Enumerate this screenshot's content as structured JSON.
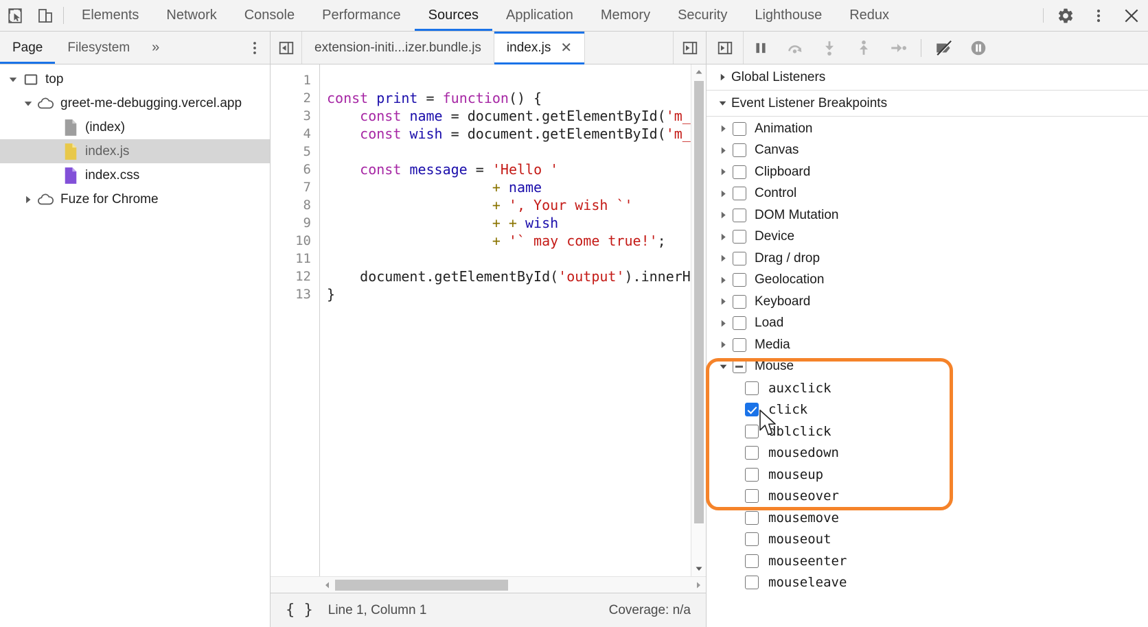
{
  "topbar": {
    "inspect_icon": "inspect-cursor-icon",
    "device_icon": "device-toolbar-icon",
    "tabs": [
      {
        "label": "Elements",
        "active": false
      },
      {
        "label": "Network",
        "active": false
      },
      {
        "label": "Console",
        "active": false
      },
      {
        "label": "Performance",
        "active": false
      },
      {
        "label": "Sources",
        "active": true
      },
      {
        "label": "Application",
        "active": false
      },
      {
        "label": "Memory",
        "active": false
      },
      {
        "label": "Security",
        "active": false
      },
      {
        "label": "Lighthouse",
        "active": false
      },
      {
        "label": "Redux",
        "active": false
      }
    ],
    "settings_icon": "gear-icon",
    "more_icon": "kebab-menu-icon",
    "close_icon": "close-icon",
    "accent_color": "#1a73e8"
  },
  "navigator": {
    "tabs": [
      {
        "label": "Page",
        "active": true
      },
      {
        "label": "Filesystem",
        "active": false
      }
    ],
    "more_label": "»",
    "kebab_icon": "kebab-menu-icon",
    "tree": [
      {
        "label": "top",
        "indent": 0,
        "arrow": "down",
        "icon": "frame-icon",
        "selected": false
      },
      {
        "label": "greet-me-debugging.vercel.app",
        "indent": 1,
        "arrow": "down",
        "icon": "cloud-icon",
        "selected": false
      },
      {
        "label": "(index)",
        "indent": 2,
        "arrow": "none",
        "icon": "document-icon",
        "selected": false
      },
      {
        "label": "index.js",
        "indent": 2,
        "arrow": "none",
        "icon": "js-file-icon",
        "selected": true
      },
      {
        "label": "index.css",
        "indent": 2,
        "arrow": "none",
        "icon": "css-file-icon",
        "selected": false
      },
      {
        "label": "Fuze for Chrome",
        "indent": 1,
        "arrow": "right",
        "icon": "cloud-icon",
        "selected": false
      }
    ]
  },
  "editor": {
    "nav_back_icon": "show-navigator-icon",
    "expand_icon": "show-debugger-icon",
    "tabs": [
      {
        "label": "extension-initi...izer.bundle.js",
        "active": false,
        "closable": false
      },
      {
        "label": "index.js",
        "active": true,
        "closable": true,
        "close_label": "✕"
      }
    ],
    "line_numbers": [
      1,
      2,
      3,
      4,
      5,
      6,
      7,
      8,
      9,
      10,
      11,
      12,
      13
    ],
    "lines": [
      [],
      [
        {
          "t": "const",
          "c": "kw"
        },
        {
          "t": " ",
          "c": "pl"
        },
        {
          "t": "print",
          "c": "id"
        },
        {
          "t": " = ",
          "c": "pl"
        },
        {
          "t": "function",
          "c": "kw"
        },
        {
          "t": "() {",
          "c": "pl"
        }
      ],
      [
        {
          "t": "    ",
          "c": "pl"
        },
        {
          "t": "const",
          "c": "kw"
        },
        {
          "t": " ",
          "c": "pl"
        },
        {
          "t": "name",
          "c": "id"
        },
        {
          "t": " = document.getElementById(",
          "c": "pl"
        },
        {
          "t": "'m_na",
          "c": "str"
        }
      ],
      [
        {
          "t": "    ",
          "c": "pl"
        },
        {
          "t": "const",
          "c": "kw"
        },
        {
          "t": " ",
          "c": "pl"
        },
        {
          "t": "wish",
          "c": "id"
        },
        {
          "t": " = document.getElementById(",
          "c": "pl"
        },
        {
          "t": "'m_wi",
          "c": "str"
        }
      ],
      [],
      [
        {
          "t": "    ",
          "c": "pl"
        },
        {
          "t": "const",
          "c": "kw"
        },
        {
          "t": " ",
          "c": "pl"
        },
        {
          "t": "message",
          "c": "id"
        },
        {
          "t": " = ",
          "c": "pl"
        },
        {
          "t": "'Hello '",
          "c": "str"
        }
      ],
      [
        {
          "t": "                    ",
          "c": "pl"
        },
        {
          "t": "+",
          "c": "op"
        },
        {
          "t": " ",
          "c": "pl"
        },
        {
          "t": "name",
          "c": "id"
        }
      ],
      [
        {
          "t": "                    ",
          "c": "pl"
        },
        {
          "t": "+",
          "c": "op"
        },
        {
          "t": " ",
          "c": "pl"
        },
        {
          "t": "', Your wish `'",
          "c": "str"
        }
      ],
      [
        {
          "t": "                    ",
          "c": "pl"
        },
        {
          "t": "+",
          "c": "op"
        },
        {
          "t": " ",
          "c": "pl"
        },
        {
          "t": "+",
          "c": "op"
        },
        {
          "t": " ",
          "c": "pl"
        },
        {
          "t": "wish",
          "c": "id"
        }
      ],
      [
        {
          "t": "                    ",
          "c": "pl"
        },
        {
          "t": "+",
          "c": "op"
        },
        {
          "t": " ",
          "c": "pl"
        },
        {
          "t": "'` may come true!'",
          "c": "str"
        },
        {
          "t": ";",
          "c": "pl"
        }
      ],
      [],
      [
        {
          "t": "    document.getElementById(",
          "c": "pl"
        },
        {
          "t": "'output'",
          "c": "str"
        },
        {
          "t": ").innerHTM",
          "c": "pl"
        }
      ],
      [
        {
          "t": "}",
          "c": "pl"
        }
      ]
    ],
    "status": {
      "format_icon": "pretty-print-braces-icon",
      "position": "Line 1, Column 1",
      "coverage": "Coverage: n/a"
    }
  },
  "debugger": {
    "collapse_icon": "show-navigator-panel-icon",
    "buttons": [
      {
        "name": "pause-script-execution",
        "icon": "pause-icon"
      },
      {
        "name": "step-over-next-function-call",
        "icon": "step-over-icon"
      },
      {
        "name": "step-into-next-function-call",
        "icon": "step-into-icon"
      },
      {
        "name": "step-out-of-current-function",
        "icon": "step-out-icon"
      },
      {
        "name": "step",
        "icon": "step-icon"
      },
      {
        "name": "deactivate-breakpoints",
        "icon": "deactivate-breakpoints-icon"
      },
      {
        "name": "pause-on-exceptions",
        "icon": "pause-on-exceptions-icon"
      }
    ],
    "sections": [
      {
        "label": "Global Listeners",
        "expanded": false
      },
      {
        "label": "Event Listener Breakpoints",
        "expanded": true
      }
    ],
    "categories": [
      {
        "label": "Animation",
        "expanded": false,
        "state": "unchecked"
      },
      {
        "label": "Canvas",
        "expanded": false,
        "state": "unchecked"
      },
      {
        "label": "Clipboard",
        "expanded": false,
        "state": "unchecked"
      },
      {
        "label": "Control",
        "expanded": false,
        "state": "unchecked"
      },
      {
        "label": "DOM Mutation",
        "expanded": false,
        "state": "unchecked"
      },
      {
        "label": "Device",
        "expanded": false,
        "state": "unchecked"
      },
      {
        "label": "Drag / drop",
        "expanded": false,
        "state": "unchecked"
      },
      {
        "label": "Geolocation",
        "expanded": false,
        "state": "unchecked"
      },
      {
        "label": "Keyboard",
        "expanded": false,
        "state": "unchecked"
      },
      {
        "label": "Load",
        "expanded": false,
        "state": "unchecked"
      },
      {
        "label": "Media",
        "expanded": false,
        "state": "unchecked"
      },
      {
        "label": "Mouse",
        "expanded": true,
        "state": "indeterminate"
      }
    ],
    "mouse_events": [
      {
        "label": "auxclick",
        "state": "unchecked"
      },
      {
        "label": "click",
        "state": "checked"
      },
      {
        "label": "dblclick",
        "state": "unchecked"
      },
      {
        "label": "mousedown",
        "state": "unchecked"
      },
      {
        "label": "mouseup",
        "state": "unchecked"
      },
      {
        "label": "mouseover",
        "state": "unchecked"
      },
      {
        "label": "mousemove",
        "state": "unchecked"
      },
      {
        "label": "mouseout",
        "state": "unchecked"
      },
      {
        "label": "mouseenter",
        "state": "unchecked"
      },
      {
        "label": "mouseleave",
        "state": "unchecked"
      }
    ]
  },
  "annotation": {
    "color": "#f5832a",
    "target": "mouse-event-listener-breakpoints-group"
  }
}
